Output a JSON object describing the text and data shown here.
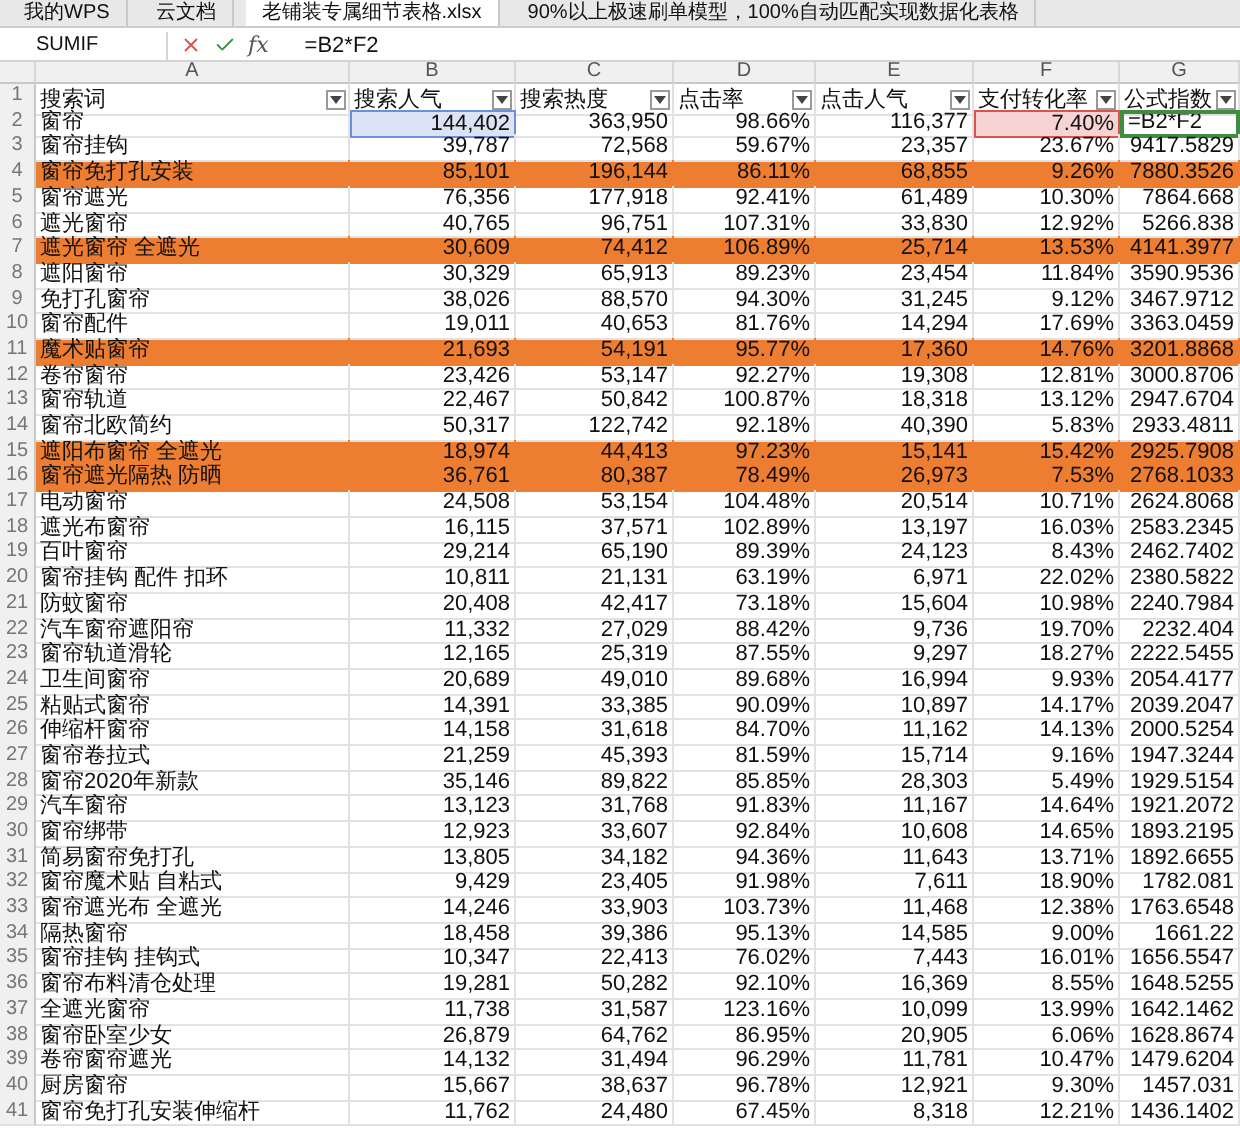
{
  "tabs": [
    {
      "label": "我的WPS",
      "selected": false
    },
    {
      "label": "云文档",
      "selected": false
    },
    {
      "label": "老铺装专属细节表格.xlsx",
      "selected": true
    },
    {
      "label": "90%以上极速刷单模型，100%自动匹配实现数据化表格",
      "selected": false
    }
  ],
  "formula_bar": {
    "name_box": "SUMIF",
    "function_label": "fx",
    "formula": "=B2*F2"
  },
  "columns": [
    "A",
    "B",
    "C",
    "D",
    "E",
    "F",
    "G"
  ],
  "header": {
    "n": "1",
    "cells": [
      "搜索词",
      "搜索人气",
      "搜索热度",
      "点击率",
      "点击人气",
      "支付转化率",
      "公式指数"
    ]
  },
  "rows": [
    {
      "n": "2",
      "highlighted": false,
      "cells": [
        {
          "v": "窗帘"
        },
        {
          "v": "144,402",
          "color": "#6d8fd8"
        },
        {
          "v": "363,950"
        },
        {
          "v": "98.66%"
        },
        {
          "v": "116,377"
        },
        {
          "v": "7.40%",
          "color": "#d9534f"
        },
        {
          "v": "=B2*F2",
          "editing": true
        }
      ]
    },
    {
      "n": "3",
      "highlighted": false,
      "cells": [
        {
          "v": "窗帘挂钩"
        },
        {
          "v": "39,787"
        },
        {
          "v": "72,568"
        },
        {
          "v": "59.67%"
        },
        {
          "v": "23,357"
        },
        {
          "v": "23.67%"
        },
        {
          "v": "9417.5829"
        }
      ]
    },
    {
      "n": "4",
      "highlighted": true,
      "cells": [
        {
          "v": "窗帘免打孔安装"
        },
        {
          "v": "85,101"
        },
        {
          "v": "196,144"
        },
        {
          "v": "86.11%"
        },
        {
          "v": "68,855"
        },
        {
          "v": "9.26%"
        },
        {
          "v": "7880.3526"
        }
      ]
    },
    {
      "n": "5",
      "highlighted": false,
      "cells": [
        {
          "v": "窗帘遮光"
        },
        {
          "v": "76,356"
        },
        {
          "v": "177,918"
        },
        {
          "v": "92.41%"
        },
        {
          "v": "61,489"
        },
        {
          "v": "10.30%"
        },
        {
          "v": "7864.668"
        }
      ]
    },
    {
      "n": "6",
      "highlighted": false,
      "cells": [
        {
          "v": "遮光窗帘"
        },
        {
          "v": "40,765"
        },
        {
          "v": "96,751"
        },
        {
          "v": "107.31%"
        },
        {
          "v": "33,830"
        },
        {
          "v": "12.92%"
        },
        {
          "v": "5266.838"
        }
      ]
    },
    {
      "n": "7",
      "highlighted": true,
      "cells": [
        {
          "v": "遮光窗帘 全遮光"
        },
        {
          "v": "30,609"
        },
        {
          "v": "74,412"
        },
        {
          "v": "106.89%"
        },
        {
          "v": "25,714"
        },
        {
          "v": "13.53%"
        },
        {
          "v": "4141.3977"
        }
      ]
    },
    {
      "n": "8",
      "highlighted": false,
      "cells": [
        {
          "v": "遮阳窗帘"
        },
        {
          "v": "30,329"
        },
        {
          "v": "65,913"
        },
        {
          "v": "89.23%"
        },
        {
          "v": "23,454"
        },
        {
          "v": "11.84%"
        },
        {
          "v": "3590.9536"
        }
      ]
    },
    {
      "n": "9",
      "highlighted": false,
      "cells": [
        {
          "v": "免打孔窗帘"
        },
        {
          "v": "38,026"
        },
        {
          "v": "88,570"
        },
        {
          "v": "94.30%"
        },
        {
          "v": "31,245"
        },
        {
          "v": "9.12%"
        },
        {
          "v": "3467.9712"
        }
      ]
    },
    {
      "n": "10",
      "highlighted": false,
      "cells": [
        {
          "v": "窗帘配件"
        },
        {
          "v": "19,011"
        },
        {
          "v": "40,653"
        },
        {
          "v": "81.76%"
        },
        {
          "v": "14,294"
        },
        {
          "v": "17.69%"
        },
        {
          "v": "3363.0459"
        }
      ]
    },
    {
      "n": "11",
      "highlighted": true,
      "cells": [
        {
          "v": "魔术贴窗帘"
        },
        {
          "v": "21,693"
        },
        {
          "v": "54,191"
        },
        {
          "v": "95.77%"
        },
        {
          "v": "17,360"
        },
        {
          "v": "14.76%"
        },
        {
          "v": "3201.8868"
        }
      ]
    },
    {
      "n": "12",
      "highlighted": false,
      "cells": [
        {
          "v": "卷帘窗帘"
        },
        {
          "v": "23,426"
        },
        {
          "v": "53,147"
        },
        {
          "v": "92.27%"
        },
        {
          "v": "19,308"
        },
        {
          "v": "12.81%"
        },
        {
          "v": "3000.8706"
        }
      ]
    },
    {
      "n": "13",
      "highlighted": false,
      "cells": [
        {
          "v": "窗帘轨道"
        },
        {
          "v": "22,467"
        },
        {
          "v": "50,842"
        },
        {
          "v": "100.87%"
        },
        {
          "v": "18,318"
        },
        {
          "v": "13.12%"
        },
        {
          "v": "2947.6704"
        }
      ]
    },
    {
      "n": "14",
      "highlighted": false,
      "cells": [
        {
          "v": "窗帘北欧简约"
        },
        {
          "v": "50,317"
        },
        {
          "v": "122,742"
        },
        {
          "v": "92.18%"
        },
        {
          "v": "40,390"
        },
        {
          "v": "5.83%"
        },
        {
          "v": "2933.4811"
        }
      ]
    },
    {
      "n": "15",
      "highlighted": true,
      "cells": [
        {
          "v": "遮阳布窗帘 全遮光"
        },
        {
          "v": "18,974"
        },
        {
          "v": "44,413"
        },
        {
          "v": "97.23%"
        },
        {
          "v": "15,141"
        },
        {
          "v": "15.42%"
        },
        {
          "v": "2925.7908"
        }
      ]
    },
    {
      "n": "16",
      "highlighted": true,
      "cells": [
        {
          "v": "窗帘遮光隔热 防晒"
        },
        {
          "v": "36,761"
        },
        {
          "v": "80,387"
        },
        {
          "v": "78.49%"
        },
        {
          "v": "26,973"
        },
        {
          "v": "7.53%"
        },
        {
          "v": "2768.1033"
        }
      ]
    },
    {
      "n": "17",
      "highlighted": false,
      "cells": [
        {
          "v": "电动窗帘"
        },
        {
          "v": "24,508"
        },
        {
          "v": "53,154"
        },
        {
          "v": "104.48%"
        },
        {
          "v": "20,514"
        },
        {
          "v": "10.71%"
        },
        {
          "v": "2624.8068"
        }
      ]
    },
    {
      "n": "18",
      "highlighted": false,
      "cells": [
        {
          "v": "遮光布窗帘"
        },
        {
          "v": "16,115"
        },
        {
          "v": "37,571"
        },
        {
          "v": "102.89%"
        },
        {
          "v": "13,197"
        },
        {
          "v": "16.03%"
        },
        {
          "v": "2583.2345"
        }
      ]
    },
    {
      "n": "19",
      "highlighted": false,
      "cells": [
        {
          "v": "百叶窗帘"
        },
        {
          "v": "29,214"
        },
        {
          "v": "65,190"
        },
        {
          "v": "89.39%"
        },
        {
          "v": "24,123"
        },
        {
          "v": "8.43%"
        },
        {
          "v": "2462.7402"
        }
      ]
    },
    {
      "n": "20",
      "highlighted": false,
      "cells": [
        {
          "v": "窗帘挂钩 配件 扣环"
        },
        {
          "v": "10,811"
        },
        {
          "v": "21,131"
        },
        {
          "v": "63.19%"
        },
        {
          "v": "6,971"
        },
        {
          "v": "22.02%"
        },
        {
          "v": "2380.5822"
        }
      ]
    },
    {
      "n": "21",
      "highlighted": false,
      "cells": [
        {
          "v": "防蚊窗帘"
        },
        {
          "v": "20,408"
        },
        {
          "v": "42,417"
        },
        {
          "v": "73.18%"
        },
        {
          "v": "15,604"
        },
        {
          "v": "10.98%"
        },
        {
          "v": "2240.7984"
        }
      ]
    },
    {
      "n": "22",
      "highlighted": false,
      "cells": [
        {
          "v": "汽车窗帘遮阳帘"
        },
        {
          "v": "11,332"
        },
        {
          "v": "27,029"
        },
        {
          "v": "88.42%"
        },
        {
          "v": "9,736"
        },
        {
          "v": "19.70%"
        },
        {
          "v": "2232.404"
        }
      ]
    },
    {
      "n": "23",
      "highlighted": false,
      "cells": [
        {
          "v": "窗帘轨道滑轮"
        },
        {
          "v": "12,165"
        },
        {
          "v": "25,319"
        },
        {
          "v": "87.55%"
        },
        {
          "v": "9,297"
        },
        {
          "v": "18.27%"
        },
        {
          "v": "2222.5455"
        }
      ]
    },
    {
      "n": "24",
      "highlighted": false,
      "cells": [
        {
          "v": "卫生间窗帘"
        },
        {
          "v": "20,689"
        },
        {
          "v": "49,010"
        },
        {
          "v": "89.68%"
        },
        {
          "v": "16,994"
        },
        {
          "v": "9.93%"
        },
        {
          "v": "2054.4177"
        }
      ]
    },
    {
      "n": "25",
      "highlighted": false,
      "cells": [
        {
          "v": "粘贴式窗帘"
        },
        {
          "v": "14,391"
        },
        {
          "v": "33,385"
        },
        {
          "v": "90.09%"
        },
        {
          "v": "10,897"
        },
        {
          "v": "14.17%"
        },
        {
          "v": "2039.2047"
        }
      ]
    },
    {
      "n": "26",
      "highlighted": false,
      "cells": [
        {
          "v": "伸缩杆窗帘"
        },
        {
          "v": "14,158"
        },
        {
          "v": "31,618"
        },
        {
          "v": "84.70%"
        },
        {
          "v": "11,162"
        },
        {
          "v": "14.13%"
        },
        {
          "v": "2000.5254"
        }
      ]
    },
    {
      "n": "27",
      "highlighted": false,
      "cells": [
        {
          "v": "窗帘卷拉式"
        },
        {
          "v": "21,259"
        },
        {
          "v": "45,393"
        },
        {
          "v": "81.59%"
        },
        {
          "v": "15,714"
        },
        {
          "v": "9.16%"
        },
        {
          "v": "1947.3244"
        }
      ]
    },
    {
      "n": "28",
      "highlighted": false,
      "cells": [
        {
          "v": "窗帘2020年新款"
        },
        {
          "v": "35,146"
        },
        {
          "v": "89,822"
        },
        {
          "v": "85.85%"
        },
        {
          "v": "28,303"
        },
        {
          "v": "5.49%"
        },
        {
          "v": "1929.5154"
        }
      ]
    },
    {
      "n": "29",
      "highlighted": false,
      "cells": [
        {
          "v": "汽车窗帘"
        },
        {
          "v": "13,123"
        },
        {
          "v": "31,768"
        },
        {
          "v": "91.83%"
        },
        {
          "v": "11,167"
        },
        {
          "v": "14.64%"
        },
        {
          "v": "1921.2072"
        }
      ]
    },
    {
      "n": "30",
      "highlighted": false,
      "cells": [
        {
          "v": "窗帘绑带"
        },
        {
          "v": "12,923"
        },
        {
          "v": "33,607"
        },
        {
          "v": "92.84%"
        },
        {
          "v": "10,608"
        },
        {
          "v": "14.65%"
        },
        {
          "v": "1893.2195"
        }
      ]
    },
    {
      "n": "31",
      "highlighted": false,
      "cells": [
        {
          "v": "简易窗帘免打孔"
        },
        {
          "v": "13,805"
        },
        {
          "v": "34,182"
        },
        {
          "v": "94.36%"
        },
        {
          "v": "11,643"
        },
        {
          "v": "13.71%"
        },
        {
          "v": "1892.6655"
        }
      ]
    },
    {
      "n": "32",
      "highlighted": false,
      "cells": [
        {
          "v": "窗帘魔术贴 自粘式"
        },
        {
          "v": "9,429"
        },
        {
          "v": "23,405"
        },
        {
          "v": "91.98%"
        },
        {
          "v": "7,611"
        },
        {
          "v": "18.90%"
        },
        {
          "v": "1782.081"
        }
      ]
    },
    {
      "n": "33",
      "highlighted": false,
      "cells": [
        {
          "v": "窗帘遮光布 全遮光"
        },
        {
          "v": "14,246"
        },
        {
          "v": "33,903"
        },
        {
          "v": "103.73%"
        },
        {
          "v": "11,468"
        },
        {
          "v": "12.38%"
        },
        {
          "v": "1763.6548"
        }
      ]
    },
    {
      "n": "34",
      "highlighted": false,
      "cells": [
        {
          "v": "隔热窗帘"
        },
        {
          "v": "18,458"
        },
        {
          "v": "39,386"
        },
        {
          "v": "95.13%"
        },
        {
          "v": "14,585"
        },
        {
          "v": "9.00%"
        },
        {
          "v": "1661.22"
        }
      ]
    },
    {
      "n": "35",
      "highlighted": false,
      "cells": [
        {
          "v": "窗帘挂钩 挂钩式"
        },
        {
          "v": "10,347"
        },
        {
          "v": "22,413"
        },
        {
          "v": "76.02%"
        },
        {
          "v": "7,443"
        },
        {
          "v": "16.01%"
        },
        {
          "v": "1656.5547"
        }
      ]
    },
    {
      "n": "36",
      "highlighted": false,
      "cells": [
        {
          "v": "窗帘布料清仓处理"
        },
        {
          "v": "19,281"
        },
        {
          "v": "50,282"
        },
        {
          "v": "92.10%"
        },
        {
          "v": "16,369"
        },
        {
          "v": "8.55%"
        },
        {
          "v": "1648.5255"
        }
      ]
    },
    {
      "n": "37",
      "highlighted": false,
      "cells": [
        {
          "v": "全遮光窗帘"
        },
        {
          "v": "11,738"
        },
        {
          "v": "31,587"
        },
        {
          "v": "123.16%"
        },
        {
          "v": "10,099"
        },
        {
          "v": "13.99%"
        },
        {
          "v": "1642.1462"
        }
      ]
    },
    {
      "n": "38",
      "highlighted": false,
      "cells": [
        {
          "v": "窗帘卧室少女"
        },
        {
          "v": "26,879"
        },
        {
          "v": "64,762"
        },
        {
          "v": "86.95%"
        },
        {
          "v": "20,905"
        },
        {
          "v": "6.06%"
        },
        {
          "v": "1628.8674"
        }
      ]
    },
    {
      "n": "39",
      "highlighted": false,
      "cells": [
        {
          "v": "卷帘窗帘遮光"
        },
        {
          "v": "14,132"
        },
        {
          "v": "31,494"
        },
        {
          "v": "96.29%"
        },
        {
          "v": "11,781"
        },
        {
          "v": "10.47%"
        },
        {
          "v": "1479.6204"
        }
      ]
    },
    {
      "n": "40",
      "highlighted": false,
      "cells": [
        {
          "v": "厨房窗帘"
        },
        {
          "v": "15,667"
        },
        {
          "v": "38,637"
        },
        {
          "v": "96.78%"
        },
        {
          "v": "12,921"
        },
        {
          "v": "9.30%"
        },
        {
          "v": "1457.031"
        }
      ]
    },
    {
      "n": "41",
      "highlighted": false,
      "cells": [
        {
          "v": "窗帘免打孔安装伸缩杆"
        },
        {
          "v": "11,762"
        },
        {
          "v": "24,480"
        },
        {
          "v": "67.45%"
        },
        {
          "v": "8,318"
        },
        {
          "v": "12.21%"
        },
        {
          "v": "1436.1402"
        }
      ]
    }
  ]
}
